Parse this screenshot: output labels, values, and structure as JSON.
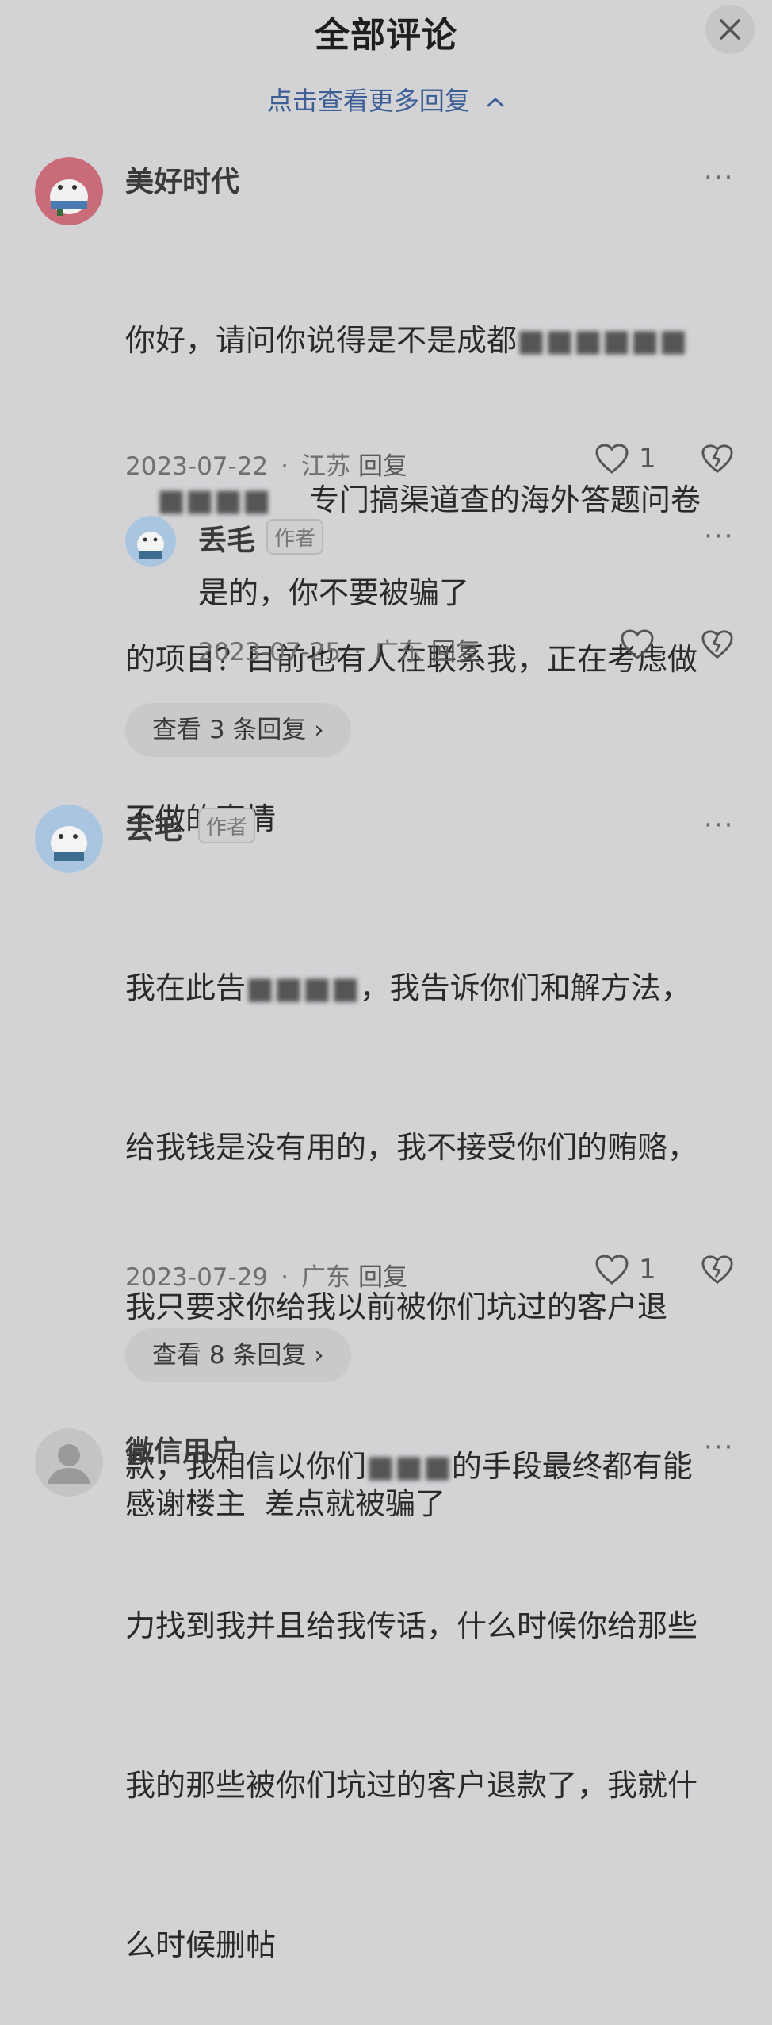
{
  "header": {
    "title": "全部评论",
    "close_icon": "close-icon"
  },
  "top_link": {
    "label": "点击查看更多回复"
  },
  "comments": [
    {
      "username": "美好时代",
      "text_line1": "你好，请问你说得是不是成都",
      "text_line2": "专门搞渠道查的海外答题问卷",
      "text_line3": "的项目？目前也有人在联系我，正在考虑做",
      "text_line4": "不做的事情",
      "date": "2023-07-22",
      "location": "江苏",
      "reply_label": "回复",
      "likes": "1"
    },
    {
      "username": "丢毛",
      "badge": "作者",
      "text": "是的，你不要被骗了",
      "date": "2023-07-25",
      "location": "广东",
      "reply_label": "回复",
      "likes": ""
    },
    {
      "view_replies": "查看 3 条回复 ›"
    },
    {
      "username": "丢毛",
      "badge": "作者",
      "lines": [
        "我在此告",
        "，我告诉你们和解方法，",
        "给我钱是没有用的，我不接受你们的贿赂，",
        "我只要求你给我以前被你们坑过的客户退",
        "款，我相信以你们",
        "的手段最终都有能",
        "力找到我并且给我传话，什么时候你给那些",
        "我的那些被你们坑过的客户退款了，我就什",
        "么时候删帖"
      ],
      "date": "2023-07-29",
      "location": "广东",
      "reply_label": "回复",
      "likes": "1"
    },
    {
      "view_replies": "查看 8 条回复 ›"
    },
    {
      "username": "微信用户",
      "text": "感谢楼主  差点就被骗了"
    }
  ],
  "meta_sep": "·",
  "dots": "···",
  "colors": {
    "background": "#d3d3d6",
    "link": "#3e5f95"
  }
}
